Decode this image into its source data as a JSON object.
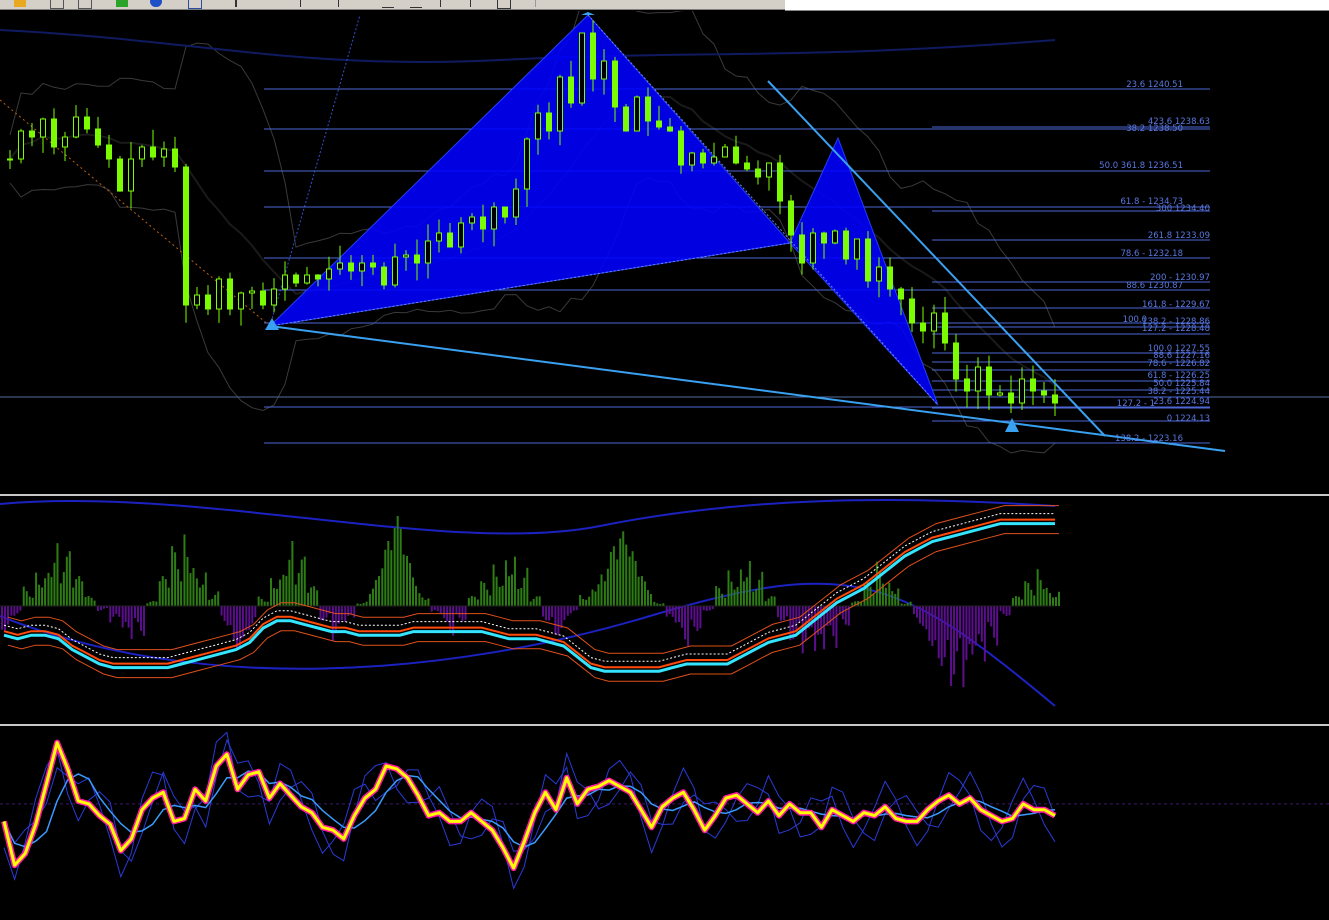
{
  "fib_left": [
    "23.6 1240.51",
    "38.2 1238.50",
    "50.0 361.8 1236.51",
    "61.8 - 1234.73",
    "78.6 - 1232.18",
    "88.6 1230.87",
    "100.0",
    "127.2 - 1",
    "138.2 - 1223.16"
  ],
  "fib_right": [
    "423.6 1238.63",
    "300 1234.40",
    "261.8 1233.09",
    "200 - 1230.97",
    "161.8 - 1229.67",
    "138.2 - 1228.86",
    "127.2 - 1228.48",
    "100.0 1227.55",
    "88.6 1227.16",
    "78.6 - 1226.82",
    "61.8 - 1226.25",
    "50.0 1225.84",
    "38.2 - 1225.44",
    "23.6 1224.94",
    "0 1224.13"
  ],
  "colors": {
    "background": "#000000",
    "candles": "#7cfc00",
    "pattern": "#0000ff",
    "trendline": "#3aa0f0",
    "fib": "#4d67d6",
    "bands": "#3a3a3a",
    "histogram_up": "#2e7d14",
    "histogram_down": "#5b0f8c",
    "macd_line": "#33e5ff",
    "osc_main": "#ffff00",
    "osc_markers": "#ff1aa3",
    "osc_signal": "#3a9bff"
  },
  "chart_data": [
    {
      "type": "line",
      "title": "",
      "series": [
        {
          "values": [
            1236.8,
            1238.2,
            1237.9,
            1238.8,
            1237.4,
            1237.9,
            1238.9,
            1238.3,
            1237.5,
            1236.8,
            1235.2,
            1236.8,
            1237.4,
            1236.9,
            1237.3,
            1236.4,
            1229.5,
            1230.0,
            1229.3,
            1230.8,
            1229.3,
            1230.1,
            1230.2,
            1229.5,
            1230.3,
            1231.0,
            1230.6,
            1231.0,
            1230.8,
            1231.3,
            1231.6,
            1231.2,
            1231.6,
            1231.4,
            1230.5,
            1231.9,
            1232.0,
            1231.6,
            1232.7,
            1233.1,
            1232.4,
            1233.6,
            1233.9,
            1233.3,
            1234.4,
            1233.9,
            1235.3,
            1237.8,
            1239.1,
            1238.2,
            1240.9,
            1239.6,
            1243.1,
            1240.8,
            1241.7,
            1239.4,
            1238.2,
            1239.9,
            1238.7,
            1238.4,
            1238.2,
            1236.5,
            1237.1,
            1236.6,
            1236.9,
            1237.4,
            1236.6,
            1236.3,
            1235.9,
            1236.6,
            1234.7,
            1233.0,
            1231.6,
            1233.1,
            1232.6,
            1233.2,
            1231.8,
            1232.8,
            1230.7,
            1231.4,
            1230.3,
            1229.8,
            1228.6,
            1228.2,
            1229.1,
            1227.6,
            1225.8,
            1225.2,
            1226.4,
            1225.0,
            1225.1,
            1224.6,
            1225.8,
            1225.2,
            1225.0,
            1224.6
          ]
        }
      ]
    },
    {
      "type": "bar",
      "series": [
        {
          "values": [
            -5,
            -2,
            4,
            9,
            14,
            11,
            6,
            2,
            -1,
            -4,
            -8,
            -6,
            1,
            6,
            12,
            16,
            9,
            3,
            -4,
            -9,
            -5,
            2,
            8,
            14,
            10,
            4,
            -3,
            -7,
            -4,
            1,
            6,
            13,
            18,
            10,
            3,
            -2,
            -6,
            -3,
            2,
            5,
            9,
            14,
            8,
            2,
            -3,
            -6,
            -2,
            3,
            7,
            12,
            15,
            11,
            6,
            1,
            -4,
            -8,
            -5,
            -1,
            4,
            8,
            12,
            7,
            2,
            -3,
            -7,
            -10,
            -13,
            -9,
            -4,
            1,
            5,
            9,
            6,
            1,
            -4,
            -8,
            -12,
            -16,
            -19,
            -14,
            -8,
            -2,
            2,
            5,
            8,
            4
          ]
        },
        {
          "values": [
            -7,
            -8,
            -7,
            -7,
            -8,
            -11,
            -13,
            -15,
            -16,
            -16,
            -16,
            -16,
            -16,
            -15,
            -14,
            -13,
            -12,
            -11,
            -9,
            -5,
            -3,
            -3,
            -4,
            -5,
            -6,
            -6,
            -7,
            -7,
            -7,
            -7,
            -6,
            -6,
            -6,
            -6,
            -6,
            -6,
            -7,
            -8,
            -8,
            -8,
            -9,
            -10,
            -13,
            -16,
            -17,
            -17,
            -17,
            -17,
            -17,
            -16,
            -15,
            -15,
            -15,
            -15,
            -13,
            -11,
            -9,
            -8,
            -7,
            -4,
            -1,
            2,
            4,
            6,
            9,
            12,
            15,
            17,
            19,
            20,
            21,
            22,
            23,
            24,
            24,
            24,
            24,
            24
          ]
        }
      ]
    },
    {
      "type": "line",
      "series": [
        {
          "values": [
            44,
            29,
            33,
            43,
            57,
            71,
            62,
            51,
            50,
            46,
            43,
            34,
            38,
            48,
            52,
            54,
            44,
            45,
            55,
            51,
            63,
            67,
            55,
            60,
            61,
            52,
            57,
            53,
            49,
            47,
            42,
            41,
            38,
            46,
            52,
            55,
            63,
            62,
            59,
            53,
            46,
            47,
            44,
            44,
            47,
            44,
            41,
            35,
            28,
            37,
            47,
            54,
            48,
            59,
            50,
            55,
            56,
            58,
            56,
            54,
            48,
            42,
            49,
            52,
            54,
            48,
            41,
            46,
            52,
            53,
            50,
            47,
            51,
            46,
            50,
            47,
            47,
            42,
            48,
            46,
            44,
            47,
            46,
            49,
            45,
            44,
            44,
            48,
            51,
            53,
            50,
            52,
            48,
            46,
            44,
            45,
            50,
            48,
            48,
            46
          ]
        }
      ]
    }
  ]
}
